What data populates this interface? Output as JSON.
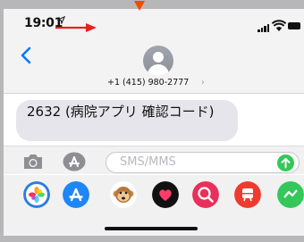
{
  "status_bar": {
    "time": "19:01",
    "location_icon": "location-arrow-icon",
    "signal_icon": "cellular-signal-icon",
    "wifi_icon": "wifi-icon",
    "battery_icon": "battery-icon"
  },
  "header": {
    "back_icon": "chevron-left-icon",
    "contact_number": "+1 (415) 980-2777",
    "contact_chevron": "›"
  },
  "messages": [
    {
      "text": "2632 (病院アプリ 確認コード)",
      "direction": "incoming"
    }
  ],
  "compose": {
    "placeholder": "SMS/MMS",
    "camera_icon": "camera-icon",
    "apps_icon": "app-store-icon",
    "send_icon": "send-arrow-up-icon",
    "send_color": "#34c759"
  },
  "app_drawer": {
    "apps": [
      {
        "name": "photos-app-icon"
      },
      {
        "name": "app-store-app-icon"
      },
      {
        "name": "animoji-monkey-icon"
      },
      {
        "name": "digital-touch-heart-icon"
      },
      {
        "name": "search-images-icon"
      },
      {
        "name": "app-red-icon"
      },
      {
        "name": "app-green-partial-icon"
      }
    ]
  },
  "colors": {
    "accent": "#007aff",
    "bubble_incoming": "#e6e5eb",
    "annotation_arrow_red": "#e8211d",
    "annotation_arrow_orange": "#f24a06"
  }
}
